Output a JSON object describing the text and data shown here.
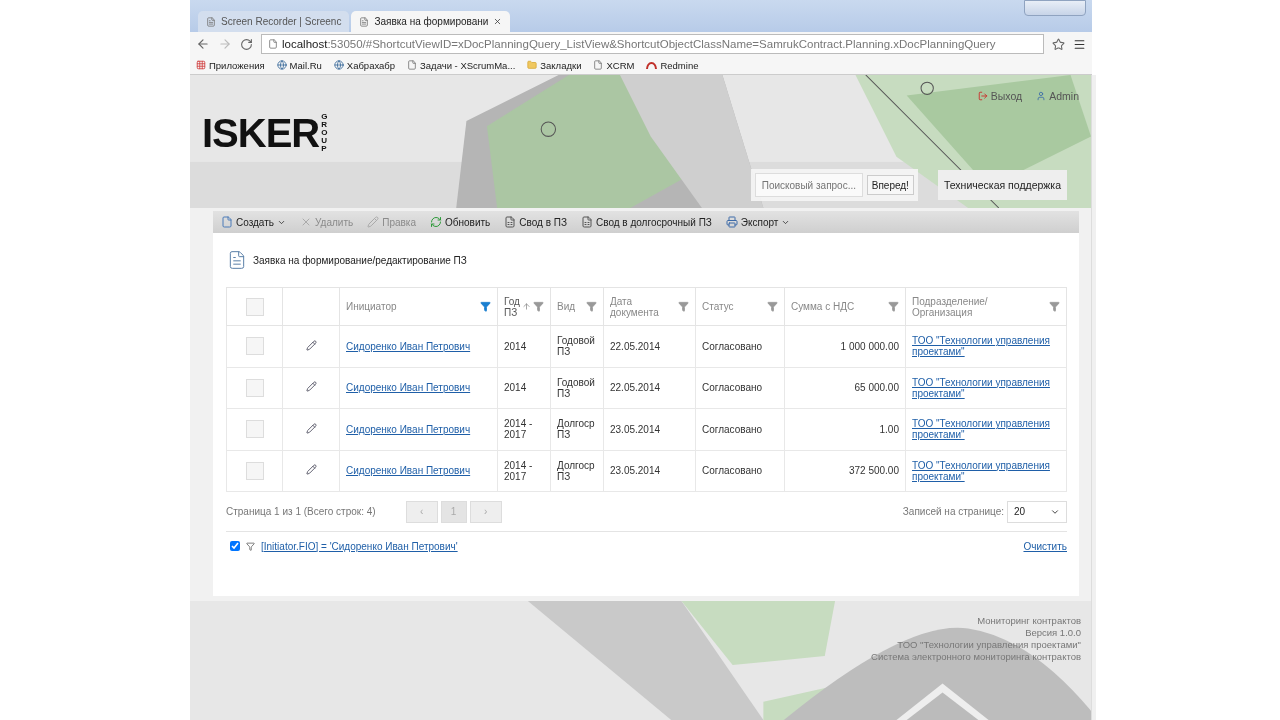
{
  "browser": {
    "tabs": [
      {
        "title": "Screen Recorder | Screenc",
        "selected": false
      },
      {
        "title": "Заявка на формировани",
        "selected": true
      }
    ],
    "url_host": "localhost",
    "url_rest": ":53050/#ShortcutViewID=xDocPlanningQuery_ListView&ShortcutObjectClassName=SamrukContract.Planning.xDocPlanningQuery",
    "bookmarks": [
      {
        "label": "Приложения",
        "kind": "apps"
      },
      {
        "label": "Mail.Ru",
        "kind": "site"
      },
      {
        "label": "Хабрахабр",
        "kind": "site"
      },
      {
        "label": "Задачи - XScrumMa...",
        "kind": "page"
      },
      {
        "label": "Закладки",
        "kind": "folder"
      },
      {
        "label": "XCRM",
        "kind": "page"
      },
      {
        "label": "Redmine",
        "kind": "redmine"
      }
    ]
  },
  "header": {
    "logo": "ISKER",
    "logo_sub": "GROUP",
    "logout": "Выход",
    "user": "Admin",
    "search_placeholder": "Поисковый запрос...",
    "search_button": "Вперед!",
    "support": "Техническая поддержка"
  },
  "toolbar": [
    {
      "label": "Создать",
      "kind": "new",
      "disabled": false,
      "dropdown": true
    },
    {
      "label": "Удалить",
      "kind": "delete",
      "disabled": true,
      "dropdown": false
    },
    {
      "label": "Правка",
      "kind": "edit",
      "disabled": true,
      "dropdown": false
    },
    {
      "label": "Обновить",
      "kind": "refresh",
      "disabled": false,
      "dropdown": false
    },
    {
      "label": "Свод в ПЗ",
      "kind": "report",
      "disabled": false,
      "dropdown": false
    },
    {
      "label": "Свод в долгосрочный ПЗ",
      "kind": "report",
      "disabled": false,
      "dropdown": false
    },
    {
      "label": "Экспорт",
      "kind": "export",
      "disabled": false,
      "dropdown": true
    }
  ],
  "title": "Заявка на формирование/редактирование ПЗ",
  "select_all": {
    "checked": false
  },
  "columns": [
    {
      "label": "Инициатор",
      "filter_active": true,
      "sorted": false
    },
    {
      "label": "Год ПЗ",
      "filter_active": false,
      "sorted": true
    },
    {
      "label": "Вид",
      "filter_active": false,
      "sorted": false
    },
    {
      "label": "Дата документа",
      "filter_active": false,
      "sorted": false
    },
    {
      "label": "Статус",
      "filter_active": false,
      "sorted": false
    },
    {
      "label": "Сумма с НДС",
      "filter_active": false,
      "sorted": false
    },
    {
      "label": "Подразделение/ Организация",
      "filter_active": false,
      "sorted": false
    }
  ],
  "rows": [
    {
      "selected": false,
      "initiator": "Сидоренко Иван Петрович",
      "year": "2014",
      "kind": "Годовой ПЗ",
      "date": "22.05.2014",
      "status": "Согласовано",
      "amount": "1 000 000.00",
      "org": "ТОО \"Технологии управления проектами\""
    },
    {
      "selected": false,
      "initiator": "Сидоренко Иван Петрович",
      "year": "2014",
      "kind": "Годовой ПЗ",
      "date": "22.05.2014",
      "status": "Согласовано",
      "amount": "65 000.00",
      "org": "ТОО \"Технологии управления проектами\""
    },
    {
      "selected": false,
      "initiator": "Сидоренко Иван Петрович",
      "year": "2014 - 2017",
      "kind": "Долгоср ПЗ",
      "date": "23.05.2014",
      "status": "Согласовано",
      "amount": "1.00",
      "org": "ТОО \"Технологии управления проектами\""
    },
    {
      "selected": false,
      "initiator": "Сидоренко Иван Петрович",
      "year": "2014 - 2017",
      "kind": "Долгоср ПЗ",
      "date": "23.05.2014",
      "status": "Согласовано",
      "amount": "372 500.00",
      "org": "ТОО \"Технологии управления проектами\""
    }
  ],
  "pager": {
    "summary": "Страница 1 из 1 (Всего строк: 4)",
    "prev": "‹",
    "page": "1",
    "next": "›",
    "size_label": "Записей на странице:",
    "size": "20"
  },
  "filter": {
    "enabled": true,
    "expression": "[Initiator.FIO] = 'Сидоренко Иван Петрович'",
    "clear": "Очистить"
  },
  "footer": [
    "Мониторинг контрактов",
    "Версия 1.0.0",
    "ТОО \"Технологии управления проектами\"",
    "Система электронного мониторинга контрактов"
  ]
}
